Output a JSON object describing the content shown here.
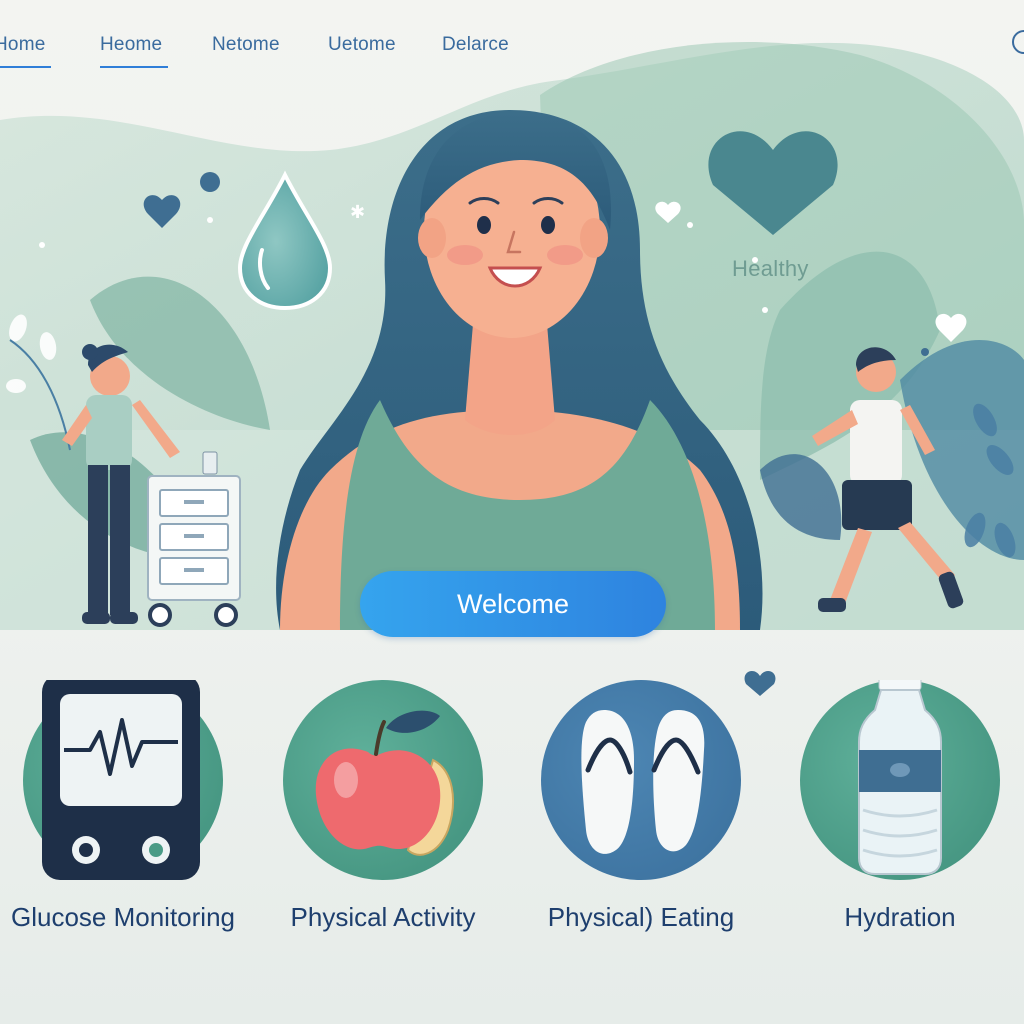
{
  "nav": {
    "items": [
      {
        "label": "Home",
        "active": true
      },
      {
        "label": "Heome",
        "active": true
      },
      {
        "label": "Netome",
        "active": false
      },
      {
        "label": "Uetome",
        "active": false
      },
      {
        "label": "Delarce",
        "active": false
      }
    ]
  },
  "hero": {
    "badge_text": "Healthy",
    "welcome_label": "Welcome"
  },
  "features": [
    {
      "label": "Glucose Monitoring",
      "icon": "glucose-monitor-icon"
    },
    {
      "label": "Physical Activity",
      "icon": "apple-icon"
    },
    {
      "label": "Physical) Eating",
      "icon": "flip-flops-icon"
    },
    {
      "label": "Hydration",
      "icon": "water-bottle-icon"
    }
  ],
  "colors": {
    "accent": "#2f7ed8",
    "nav_text": "#3a6b9e",
    "feature_text": "#1e3f6e",
    "green_circle": "#4a9b86",
    "blue_circle": "#3f79a7"
  }
}
